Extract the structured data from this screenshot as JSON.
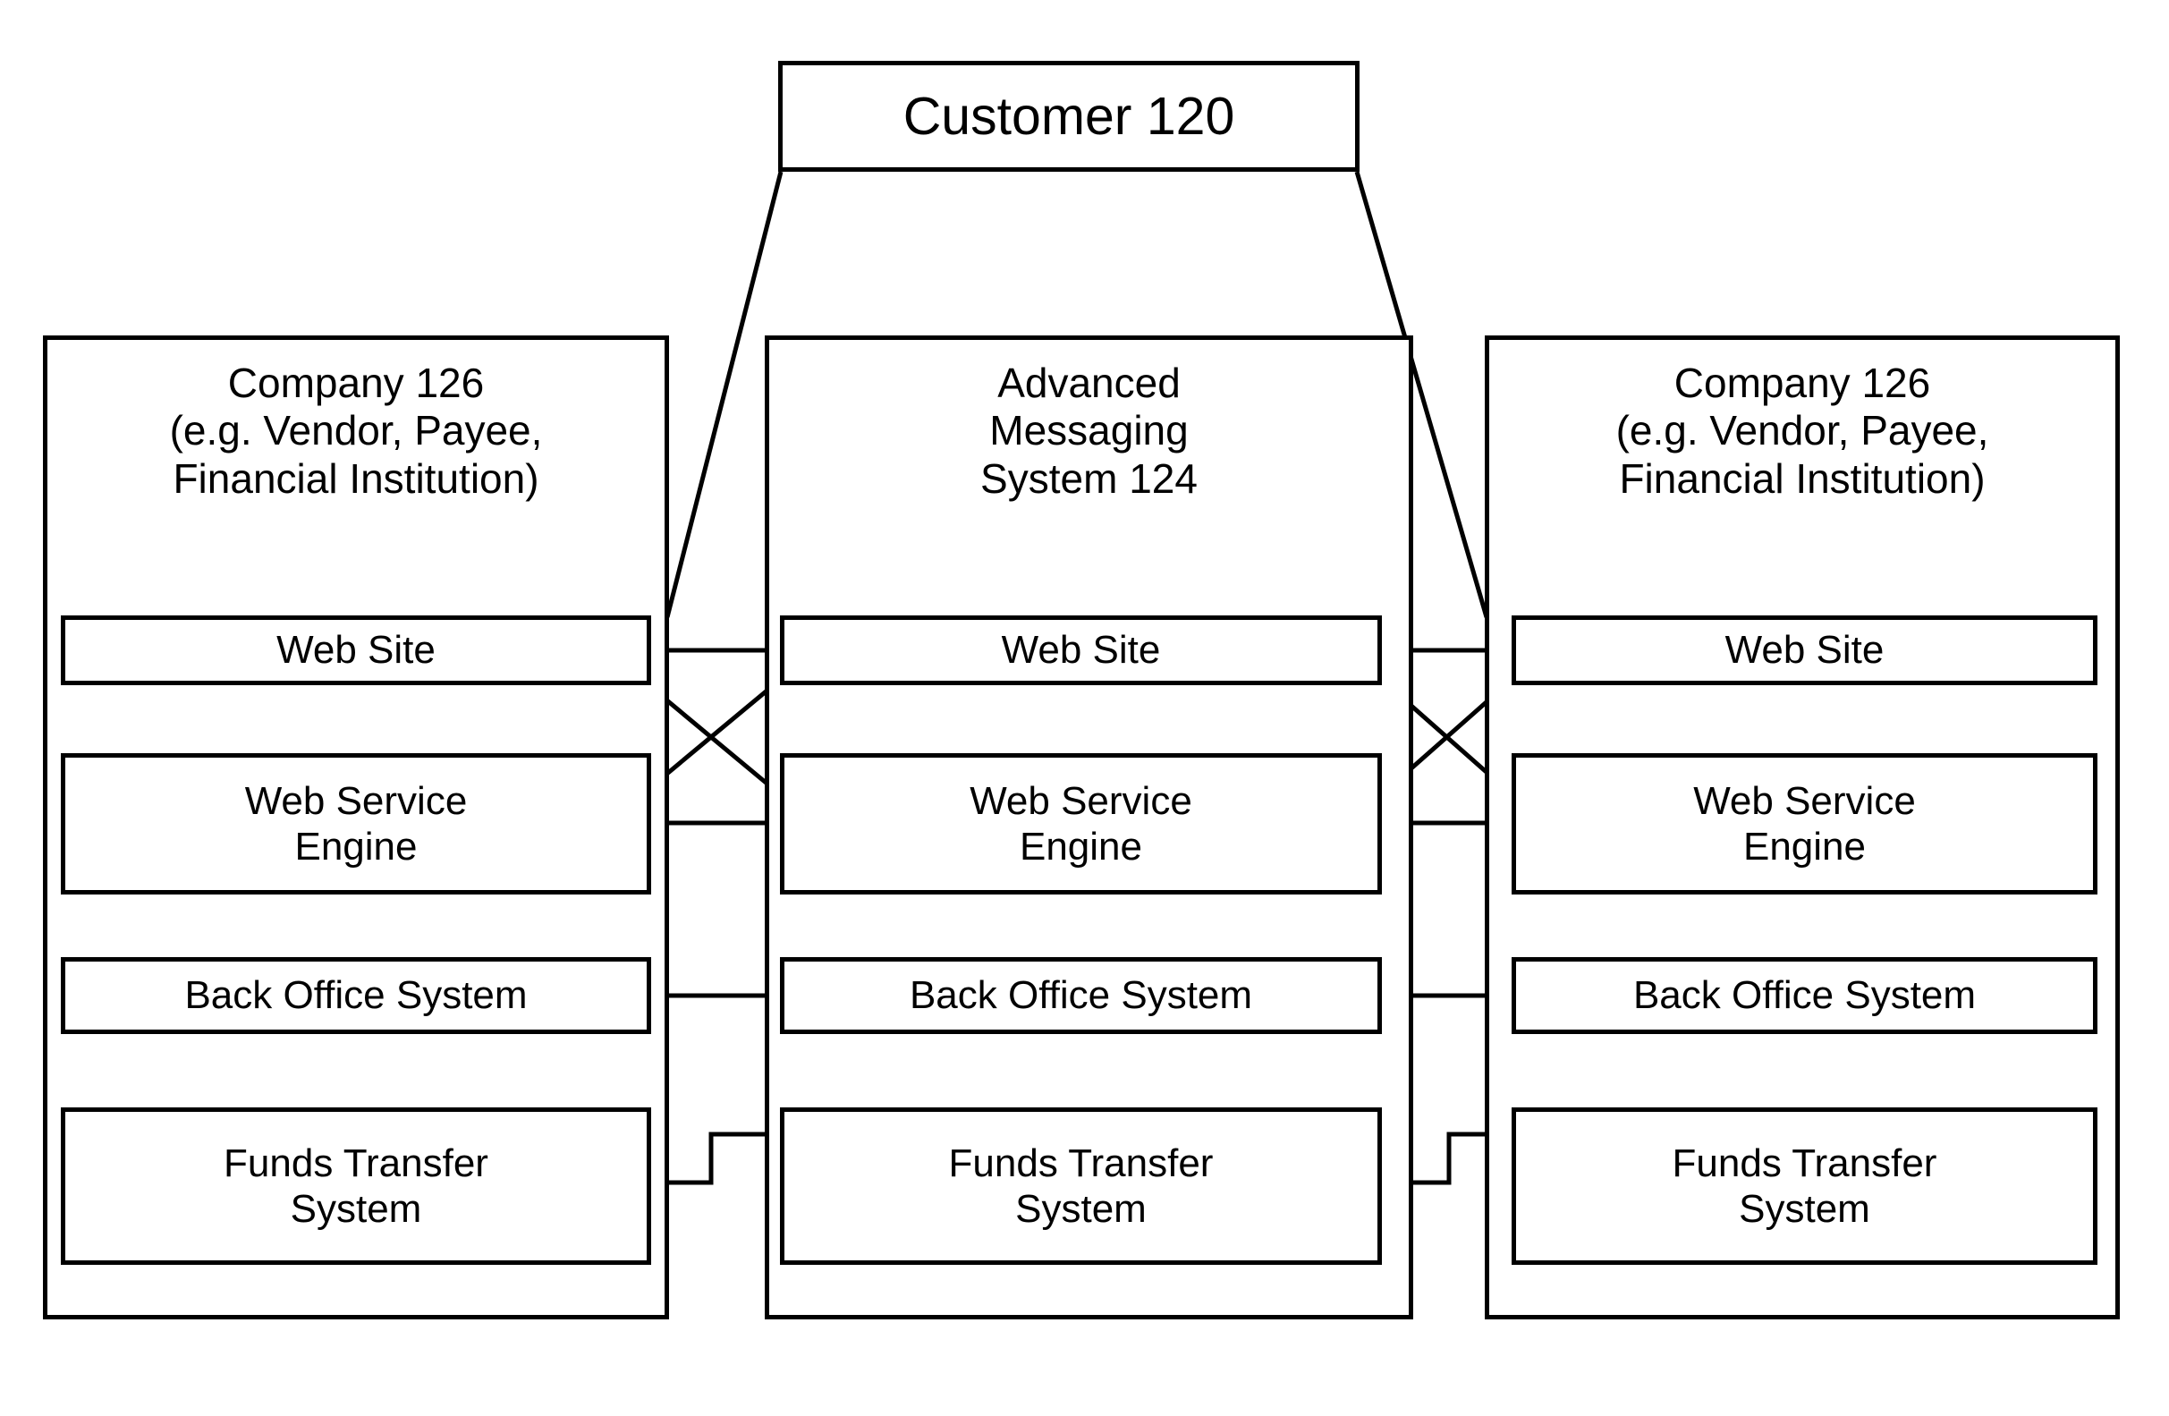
{
  "diagram": {
    "customer": {
      "label": "Customer 120"
    },
    "columns": [
      {
        "id": "left-company",
        "header": "Company 126\n(e.g. Vendor, Payee,\nFinancial Institution)",
        "blocks": [
          {
            "id": "web-site",
            "label": "Web Site"
          },
          {
            "id": "web-service",
            "label": "Web Service\nEngine"
          },
          {
            "id": "back-office",
            "label": "Back Office System"
          },
          {
            "id": "funds-transfer",
            "label": "Funds Transfer\nSystem"
          }
        ]
      },
      {
        "id": "messaging-system",
        "header": "Advanced\nMessaging\nSystem 124",
        "blocks": [
          {
            "id": "web-site",
            "label": "Web Site"
          },
          {
            "id": "web-service",
            "label": "Web Service\nEngine"
          },
          {
            "id": "back-office",
            "label": "Back Office System"
          },
          {
            "id": "funds-transfer",
            "label": "Funds Transfer\nSystem"
          }
        ]
      },
      {
        "id": "right-company",
        "header": "Company 126\n(e.g. Vendor, Payee,\nFinancial Institution)",
        "blocks": [
          {
            "id": "web-site",
            "label": "Web Site"
          },
          {
            "id": "web-service",
            "label": "Web Service\nEngine"
          },
          {
            "id": "back-office",
            "label": "Back Office System"
          },
          {
            "id": "funds-transfer",
            "label": "Funds Transfer\nSystem"
          }
        ]
      }
    ],
    "colors": {
      "stroke": "#000000",
      "fill": "#ffffff"
    }
  }
}
